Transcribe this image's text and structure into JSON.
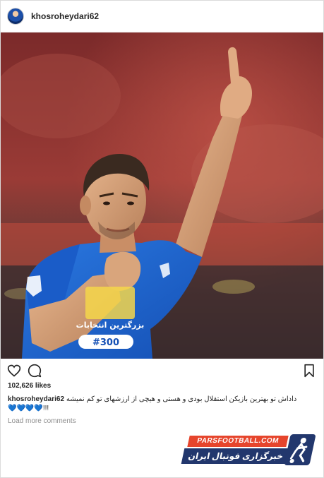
{
  "post": {
    "username": "khosroheydari62",
    "likes": "102,626 likes",
    "caption_user": "khosroheydari62",
    "caption_text": "داداش تو بهترین بازیکن استقلال بودی و هستی و هیچی از ارزشهای تو کم نمیشه",
    "caption_hearts": "💙💙💙💙",
    "caption_tail": "!!!",
    "load_more": "Load more comments"
  },
  "jersey": {
    "sponsor_text": "بزرگترین انتخابات",
    "number_text": "#300"
  },
  "watermark": {
    "site": "PARSFOOTBALL.COM",
    "tagline": "خبرگزاری فوتبال ایران"
  },
  "colors": {
    "jersey_blue": "#1d5fc9",
    "brand_red": "#e6452c",
    "brand_navy": "#22376d",
    "heart_teal": "#1fb7c4"
  },
  "icons": [
    "heart-icon",
    "comment-icon",
    "bookmark-icon",
    "soccer-player-logo-icon"
  ]
}
